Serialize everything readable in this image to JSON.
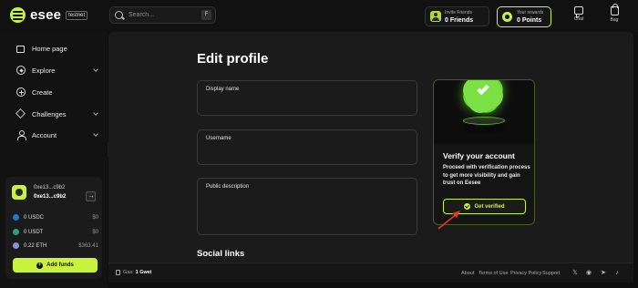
{
  "brand": {
    "name": "esee",
    "badge": "testnet"
  },
  "search": {
    "placeholder": "Search...",
    "shortcut": "F"
  },
  "invite": {
    "label": "Invite Friends",
    "value": "0 Friends"
  },
  "rewards": {
    "label": "Your rewards",
    "value": "0 Points",
    "accent": "#c9f23c"
  },
  "topnav": {
    "chat": "Chat",
    "bag": "Bag"
  },
  "sidebar": {
    "items": [
      {
        "label": "Home page",
        "icon": "home-icon"
      },
      {
        "label": "Explore",
        "icon": "compass-icon"
      },
      {
        "label": "Create",
        "icon": "plus-circle-icon"
      },
      {
        "label": "Challenges",
        "icon": "cube-icon"
      },
      {
        "label": "Account",
        "icon": "user-icon"
      }
    ]
  },
  "wallet": {
    "address_short": "0xe13...c9b2",
    "address_bold": "0xe13...c9b2",
    "tokens": [
      {
        "name": "0 USDC",
        "value": "$0",
        "color": "#2775ca"
      },
      {
        "name": "0 USDT",
        "value": "$0",
        "color": "#26a17b"
      },
      {
        "name": "0.22 ETH",
        "value": "$363.41",
        "color": "#8a92d8"
      }
    ],
    "add_funds": "Add funds"
  },
  "main": {
    "title": "Edit profile",
    "fields": [
      {
        "label": "Display name",
        "value": ""
      },
      {
        "label": "Username",
        "value": ""
      },
      {
        "label": "Public description",
        "value": ""
      }
    ],
    "social_title": "Social links"
  },
  "verify": {
    "title": "Verify your account",
    "description": "Proceed with verification process to get more visibility and gain trust on Eesee",
    "button": "Get verified"
  },
  "footer": {
    "gas_label": "Gas:",
    "gas_value": "1 Gwei",
    "links": [
      "About",
      "Terms of Use",
      "Privacy Policy",
      "Support"
    ],
    "socials": [
      "twitter-icon",
      "discord-icon",
      "telegram-icon",
      "tiktok-icon"
    ]
  }
}
